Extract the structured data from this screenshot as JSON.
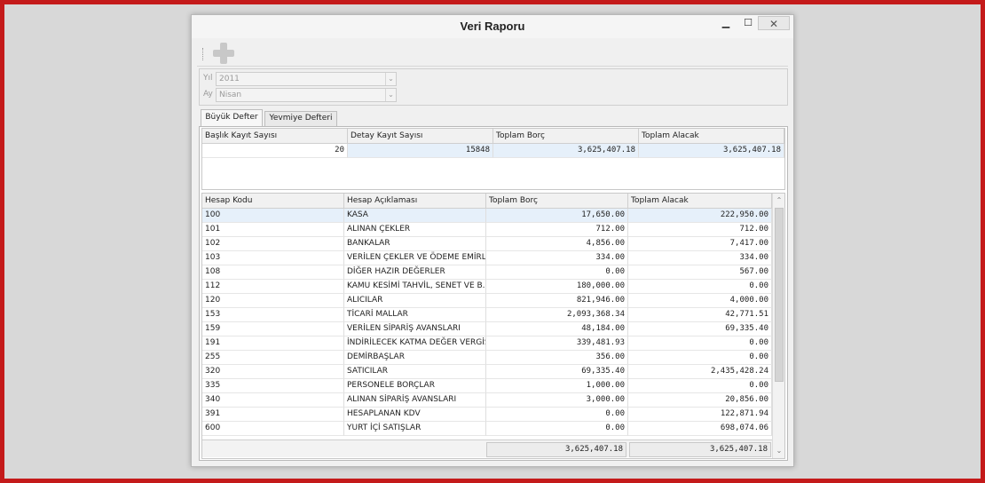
{
  "window": {
    "title": "Veri Raporu",
    "min_glyph": "▁",
    "max_glyph": "☐",
    "close_glyph": "✕"
  },
  "filters": {
    "year_label": "Yıl",
    "year_value": "2011",
    "month_label": "Ay",
    "month_value": "Nisan",
    "dropdown_glyph": "⌄"
  },
  "tabs": [
    {
      "label": "Büyük Defter"
    },
    {
      "label": "Yevmiye Defteri"
    }
  ],
  "summary": {
    "headers": [
      "Başlık Kayıt Sayısı",
      "Detay Kayıt Sayısı",
      "Toplam Borç",
      "Toplam Alacak"
    ],
    "row": [
      "20",
      "15848",
      "3,625,407.18",
      "3,625,407.18"
    ]
  },
  "accounts": {
    "headers": [
      "Hesap Kodu",
      "Hesap Açıklaması",
      "Toplam Borç",
      "Toplam Alacak"
    ],
    "rows": [
      [
        "100",
        "KASA",
        "17,650.00",
        "222,950.00"
      ],
      [
        "101",
        "ALINAN ÇEKLER",
        "712.00",
        "712.00"
      ],
      [
        "102",
        "BANKALAR",
        "4,856.00",
        "7,417.00"
      ],
      [
        "103",
        "VERİLEN ÇEKLER VE ÖDEME EMİRL...",
        "334.00",
        "334.00"
      ],
      [
        "108",
        "DİĞER HAZIR DEĞERLER",
        "0.00",
        "567.00"
      ],
      [
        "112",
        "KAMU KESİMİ TAHVİL, SENET VE B...",
        "180,000.00",
        "0.00"
      ],
      [
        "120",
        "ALICILAR",
        "821,946.00",
        "4,000.00"
      ],
      [
        "153",
        "TİCARİ MALLAR",
        "2,093,368.34",
        "42,771.51"
      ],
      [
        "159",
        "VERİLEN SİPARİŞ AVANSLARI",
        "48,184.00",
        "69,335.40"
      ],
      [
        "191",
        "İNDİRİLECEK KATMA DEĞER VERGİSİ",
        "339,481.93",
        "0.00"
      ],
      [
        "255",
        "DEMİRBAŞLAR",
        "356.00",
        "0.00"
      ],
      [
        "320",
        "SATICILAR",
        "69,335.40",
        "2,435,428.24"
      ],
      [
        "335",
        "PERSONELE BORÇLAR",
        "1,000.00",
        "0.00"
      ],
      [
        "340",
        "ALINAN SİPARİŞ AVANSLARI",
        "3,000.00",
        "20,856.00"
      ],
      [
        "391",
        "HESAPLANAN KDV",
        "0.00",
        "122,871.94"
      ],
      [
        "600",
        "YURT İÇİ SATIŞLAR",
        "0.00",
        "698,074.06"
      ]
    ],
    "total_borc": "3,625,407.18",
    "total_alacak": "3,625,407.18"
  },
  "scroll": {
    "up_glyph": "⌃",
    "down_glyph": "⌄"
  }
}
